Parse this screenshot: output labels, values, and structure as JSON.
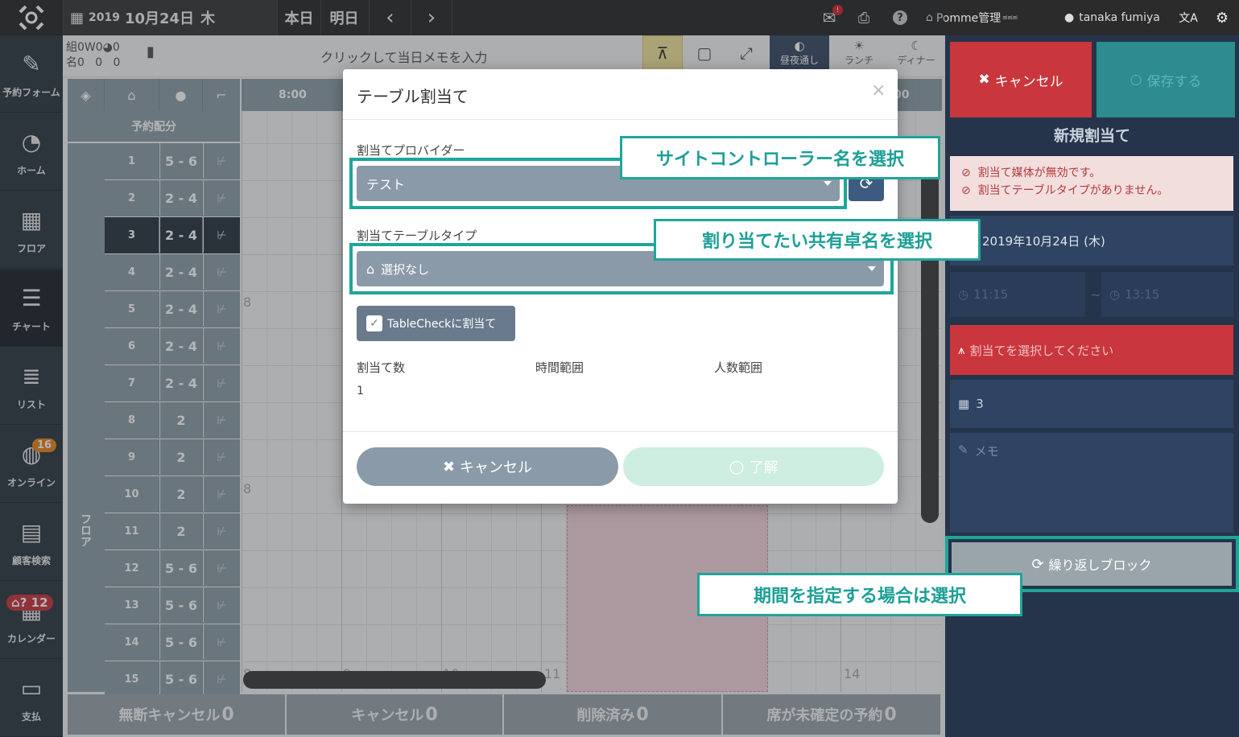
{
  "topbar": {
    "year": "2019",
    "date": "10月24日",
    "weekday": "木",
    "today_label": "本日",
    "tomorrow_label": "明日",
    "mail_badge": "!",
    "store_name": "Pomme管理",
    "user_name": "tanaka fumiya"
  },
  "nav": [
    {
      "label": "予約フォーム",
      "icon": "edit-icon"
    },
    {
      "label": "ホーム",
      "icon": "dashboard-icon"
    },
    {
      "label": "フロア",
      "icon": "floor-icon"
    },
    {
      "label": "チャート",
      "icon": "chart-icon"
    },
    {
      "label": "リスト",
      "icon": "list-icon"
    },
    {
      "label": "オンライン",
      "icon": "globe-icon",
      "badge": "16"
    },
    {
      "label": "顧客検索",
      "icon": "customer-card-icon"
    },
    {
      "label": "カレンダー",
      "icon": "calendar-icon",
      "badge": "12"
    },
    {
      "label": "支払",
      "icon": "credit-card-icon"
    }
  ],
  "memo_bar": {
    "counts_line1": "組0W0",
    "counts_line1b": "0",
    "counts_line2": "名0   0   0",
    "memo_placeholder": "クリックして当日メモを入力",
    "view_buttons": {
      "day_night": "昼夜通し",
      "lunch": "ランチ",
      "dinner": "ディナー"
    }
  },
  "chart": {
    "header_time": "8:00",
    "header_time_right": "00",
    "allocation_label": "予約配分",
    "floor_label": "フロア",
    "rows": [
      {
        "no": "1",
        "cap": "5 - 6"
      },
      {
        "no": "2",
        "cap": "2 - 4"
      },
      {
        "no": "3",
        "cap": "2 - 4"
      },
      {
        "no": "4",
        "cap": "2 - 4"
      },
      {
        "no": "5",
        "cap": "2 - 4"
      },
      {
        "no": "6",
        "cap": "2 - 4"
      },
      {
        "no": "7",
        "cap": "2 - 4"
      },
      {
        "no": "8",
        "cap": "2"
      },
      {
        "no": "9",
        "cap": "2"
      },
      {
        "no": "10",
        "cap": "2"
      },
      {
        "no": "11",
        "cap": "2"
      },
      {
        "no": "12",
        "cap": "5 - 6"
      },
      {
        "no": "13",
        "cap": "5 - 6"
      },
      {
        "no": "14",
        "cap": "5 - 6"
      },
      {
        "no": "15",
        "cap": "5 - 6"
      }
    ],
    "hour_marks": {
      "a": "8",
      "b": "8",
      "c": "8",
      "d": "9",
      "e": "10",
      "f": "11",
      "g": "14"
    },
    "footer": [
      {
        "label": "無断キャンセル",
        "count": "0"
      },
      {
        "label": "キャンセル",
        "count": "0"
      },
      {
        "label": "削除済み",
        "count": "0"
      },
      {
        "label": "席が未確定の予約",
        "count": "0"
      }
    ]
  },
  "right_panel": {
    "cancel_label": "キャンセル",
    "save_label": "保存する",
    "title": "新規割当て",
    "errors": [
      "割当て媒体が無効です。",
      "割当てテーブルタイプがありません。"
    ],
    "date": "2019年10月24日 (木)",
    "start_time": "11:15",
    "end_time": "13:15",
    "assign_prompt": "割当てを選択してください",
    "table_no": "3",
    "memo_placeholder": "メモ",
    "repeat_block_label": "繰り返しブロック"
  },
  "modal": {
    "title": "テーブル割当て",
    "close": "×",
    "provider_label": "割当てプロバイダー",
    "provider_value": "テスト",
    "table_type_label": "割当てテーブルタイプ",
    "table_type_value": "選択なし",
    "checkbox_label": "TableCheckに割当て",
    "col_count": "割当て数",
    "col_time": "時間範囲",
    "col_people": "人数範囲",
    "count_value": "1",
    "cancel_label": "キャンセル",
    "ok_label": "了解"
  },
  "callouts": {
    "provider": "サイトコントローラー名を選択",
    "table_type": "割り当てたい共有卓名を選択",
    "repeat": "期間を指定する場合は選択"
  },
  "colors": {
    "accent_teal": "#1fa59a",
    "danger": "#c9363d",
    "nav_bg": "#2f3942"
  }
}
